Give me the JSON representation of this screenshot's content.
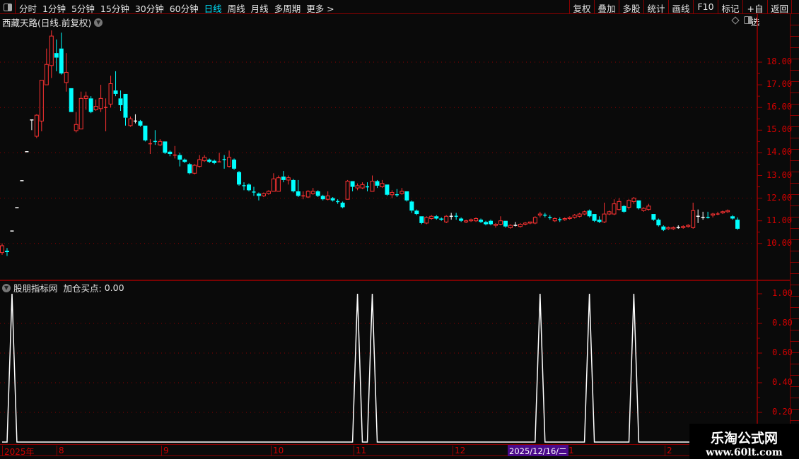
{
  "toolbar": {
    "periods": [
      "分时",
      "1分钟",
      "5分钟",
      "15分钟",
      "30分钟",
      "60分钟",
      "日线",
      "周线",
      "月线",
      "多周期",
      "更多 >"
    ],
    "active_period": "日线",
    "actions": [
      "复权",
      "叠加",
      "多股",
      "统计",
      "画线",
      "F10",
      "标记",
      "+自选",
      "返回"
    ]
  },
  "main_chart": {
    "title": "西藏天路(日线.前复权)",
    "type": "candlestick",
    "y_ticks": [
      "18.00",
      "17.00",
      "16.00",
      "15.00",
      "14.00",
      "13.00",
      "12.00",
      "11.00",
      "10.00"
    ],
    "ylim": [
      9.1,
      19.6
    ],
    "colors": {
      "up": "#ff3232",
      "down": "#00ffff",
      "flat": "#ffffff",
      "grid": "#8b0000",
      "axis_text": "#d40000"
    },
    "candles": [
      [
        9.6,
        10.0,
        9.5,
        9.9
      ],
      [
        9.68,
        9.8,
        9.45,
        9.62
      ],
      [
        10.55,
        10.55,
        10.55,
        10.55,
        "w"
      ],
      [
        11.58,
        11.58,
        11.58,
        11.58,
        "w"
      ],
      [
        12.77,
        12.77,
        12.77,
        12.77,
        "w"
      ],
      [
        14.05,
        14.05,
        14.05,
        14.05,
        "w"
      ],
      [
        15.45,
        15.45,
        15.0,
        15.45,
        "w"
      ],
      [
        14.73,
        15.7,
        14.65,
        15.66
      ],
      [
        15.4,
        17.2,
        14.95,
        17.2
      ],
      [
        17.0,
        18.6,
        17.0,
        17.9
      ],
      [
        17.85,
        19.4,
        17.3,
        19.15
      ],
      [
        18.4,
        19.0,
        17.6,
        18.2
      ],
      [
        18.6,
        19.3,
        17.45,
        17.5
      ],
      [
        17.1,
        18.4,
        16.7,
        17.55
      ],
      [
        16.85,
        16.85,
        15.8,
        15.8
      ],
      [
        14.98,
        15.8,
        14.9,
        15.25
      ],
      [
        15.05,
        16.7,
        15.05,
        16.4
      ],
      [
        16.4,
        16.7,
        15.9,
        16.5
      ],
      [
        16.4,
        16.5,
        15.75,
        15.8
      ],
      [
        15.9,
        16.35,
        15.85,
        16.05
      ],
      [
        15.95,
        17.0,
        15.8,
        16.4
      ],
      [
        16.0,
        16.4,
        14.95,
        16.0,
        "r"
      ],
      [
        16.15,
        17.4,
        16.0,
        17.05
      ],
      [
        16.75,
        17.6,
        16.5,
        16.6
      ],
      [
        16.4,
        16.75,
        15.85,
        16.1
      ],
      [
        16.6,
        16.6,
        15.2,
        15.55
      ],
      [
        15.2,
        15.6,
        15.15,
        15.5
      ],
      [
        15.4,
        15.7,
        15.3,
        15.4,
        "w"
      ],
      [
        15.4,
        15.45,
        15.15,
        15.2
      ],
      [
        15.2,
        15.2,
        14.5,
        14.55
      ],
      [
        14.4,
        14.6,
        13.95,
        14.4,
        "r"
      ],
      [
        14.5,
        15.0,
        14.35,
        14.5,
        "c"
      ],
      [
        14.35,
        14.6,
        14.3,
        14.5
      ],
      [
        14.5,
        14.5,
        13.95,
        14.0
      ],
      [
        14.05,
        14.1,
        13.85,
        13.95
      ],
      [
        13.9,
        14.3,
        13.75,
        13.9,
        "r"
      ],
      [
        13.9,
        14.0,
        13.4,
        13.7
      ],
      [
        13.7,
        13.75,
        13.55,
        13.6
      ],
      [
        13.5,
        13.55,
        13.05,
        13.1
      ],
      [
        13.1,
        13.5,
        13.05,
        13.45
      ],
      [
        13.4,
        13.9,
        13.35,
        13.7
      ],
      [
        13.65,
        13.9,
        13.6,
        13.8
      ],
      [
        13.7,
        13.75,
        13.55,
        13.6
      ],
      [
        13.65,
        13.7,
        13.5,
        13.55
      ],
      [
        13.6,
        14.0,
        13.6,
        13.6,
        "r"
      ],
      [
        13.7,
        13.9,
        13.3,
        13.7,
        "c"
      ],
      [
        13.4,
        14.1,
        13.35,
        13.8
      ],
      [
        13.7,
        13.75,
        13.25,
        13.3
      ],
      [
        13.15,
        13.2,
        12.55,
        12.6
      ],
      [
        12.55,
        12.7,
        12.35,
        12.55,
        "c"
      ],
      [
        12.6,
        12.65,
        12.3,
        12.35
      ],
      [
        12.27,
        12.5,
        12.1,
        12.27,
        "c"
      ],
      [
        12.2,
        12.25,
        11.9,
        12.1
      ],
      [
        12.1,
        12.25,
        12.05,
        12.2
      ],
      [
        12.2,
        12.35,
        12.15,
        12.3
      ],
      [
        12.3,
        13.1,
        12.3,
        12.85
      ],
      [
        12.3,
        13.0,
        12.3,
        12.9
      ],
      [
        12.95,
        13.2,
        12.7,
        12.8
      ],
      [
        12.8,
        13.0,
        12.6,
        12.9
      ],
      [
        12.8,
        12.85,
        12.25,
        12.3
      ],
      [
        12.3,
        12.8,
        12.05,
        12.1
      ],
      [
        12.1,
        12.3,
        11.95,
        12.1,
        "r"
      ],
      [
        12.05,
        12.35,
        12.0,
        12.3
      ],
      [
        12.2,
        12.45,
        12.15,
        12.3
      ],
      [
        12.3,
        12.35,
        12.05,
        12.1
      ],
      [
        12.1,
        12.15,
        11.9,
        11.95
      ],
      [
        11.95,
        12.3,
        11.9,
        12.1
      ],
      [
        12.0,
        12.05,
        11.85,
        11.9
      ],
      [
        11.85,
        11.95,
        11.75,
        11.85,
        "c"
      ],
      [
        11.8,
        11.85,
        11.55,
        11.6
      ],
      [
        11.95,
        12.8,
        11.95,
        12.75
      ],
      [
        12.75,
        12.75,
        12.3,
        12.5
      ],
      [
        12.45,
        12.65,
        12.35,
        12.55
      ],
      [
        12.45,
        12.7,
        12.4,
        12.6
      ],
      [
        12.5,
        12.7,
        12.3,
        12.5,
        "c"
      ],
      [
        12.3,
        13.0,
        12.3,
        12.75
      ],
      [
        12.75,
        12.8,
        12.45,
        12.55
      ],
      [
        12.5,
        12.8,
        12.45,
        12.65
      ],
      [
        12.6,
        12.6,
        12.1,
        12.15
      ],
      [
        12.15,
        12.35,
        12.0,
        12.25
      ],
      [
        12.15,
        12.4,
        12.05,
        12.15,
        "c"
      ],
      [
        12.2,
        12.45,
        12.15,
        12.3
      ],
      [
        12.3,
        12.3,
        11.85,
        11.9
      ],
      [
        11.85,
        11.9,
        11.35,
        11.45
      ],
      [
        11.45,
        11.5,
        11.25,
        11.3
      ],
      [
        11.2,
        11.2,
        10.85,
        10.9
      ],
      [
        10.9,
        11.2,
        10.85,
        11.15
      ],
      [
        11.1,
        11.25,
        11.05,
        11.2
      ],
      [
        11.2,
        11.25,
        11.05,
        11.1
      ],
      [
        11.1,
        11.15,
        11.0,
        11.05
      ],
      [
        10.95,
        11.25,
        10.9,
        11.2
      ],
      [
        11.2,
        11.35,
        11.05,
        11.2,
        "w"
      ],
      [
        11.2,
        11.35,
        11.05,
        11.2,
        "c"
      ],
      [
        11.1,
        11.15,
        10.95,
        11.0
      ],
      [
        10.95,
        11.05,
        10.9,
        11.0
      ],
      [
        11.0,
        11.1,
        10.95,
        11.05
      ],
      [
        11.0,
        11.15,
        10.95,
        11.1
      ],
      [
        11.05,
        11.1,
        10.9,
        10.95
      ],
      [
        10.95,
        11.0,
        10.8,
        10.85
      ],
      [
        11.0,
        11.05,
        10.8,
        10.85
      ],
      [
        10.8,
        10.9,
        10.7,
        10.85
      ],
      [
        10.85,
        11.2,
        10.8,
        11.0
      ],
      [
        11.0,
        11.0,
        10.7,
        10.75
      ],
      [
        10.7,
        10.85,
        10.65,
        10.8
      ],
      [
        10.8,
        10.95,
        10.75,
        10.8,
        "w"
      ],
      [
        10.75,
        10.9,
        10.7,
        10.85
      ],
      [
        10.85,
        10.95,
        10.8,
        10.9
      ],
      [
        10.9,
        10.95,
        10.85,
        10.95
      ],
      [
        10.9,
        11.2,
        10.85,
        11.15
      ],
      [
        11.25,
        11.4,
        11.15,
        11.3
      ],
      [
        11.25,
        11.35,
        11.15,
        11.25,
        "c"
      ],
      [
        11.15,
        11.25,
        11.05,
        11.15,
        "c"
      ],
      [
        11.0,
        11.15,
        10.95,
        11.1
      ],
      [
        11.05,
        11.15,
        10.95,
        11.05,
        "c"
      ],
      [
        11.05,
        11.15,
        11.0,
        11.1
      ],
      [
        11.1,
        11.2,
        11.05,
        11.15
      ],
      [
        11.15,
        11.3,
        11.1,
        11.25
      ],
      [
        11.2,
        11.35,
        11.15,
        11.3
      ],
      [
        11.3,
        11.45,
        11.25,
        11.4
      ],
      [
        11.45,
        11.5,
        11.15,
        11.2
      ],
      [
        11.3,
        11.3,
        10.95,
        11.0
      ],
      [
        11.05,
        11.2,
        10.9,
        10.95
      ],
      [
        10.95,
        11.8,
        10.9,
        11.3
      ],
      [
        11.3,
        11.45,
        11.25,
        11.4
      ],
      [
        11.3,
        11.95,
        11.25,
        11.75
      ],
      [
        11.5,
        12.0,
        11.45,
        11.85
      ],
      [
        11.65,
        11.7,
        11.35,
        11.4
      ],
      [
        11.6,
        11.95,
        11.5,
        11.9
      ],
      [
        11.85,
        12.05,
        11.75,
        12.0
      ],
      [
        11.9,
        11.9,
        11.5,
        11.55
      ],
      [
        11.45,
        11.6,
        11.4,
        11.55
      ],
      [
        11.5,
        11.75,
        11.45,
        11.65
      ],
      [
        11.3,
        11.3,
        11.0,
        11.05
      ],
      [
        11.05,
        11.1,
        10.75,
        10.8
      ],
      [
        10.75,
        10.8,
        10.55,
        10.6
      ],
      [
        10.65,
        10.75,
        10.6,
        10.7
      ],
      [
        10.65,
        10.75,
        10.6,
        10.7
      ],
      [
        10.7,
        10.8,
        10.65,
        10.7,
        "w"
      ],
      [
        10.7,
        10.8,
        10.65,
        10.75
      ],
      [
        10.75,
        10.85,
        10.7,
        10.8
      ],
      [
        10.7,
        11.8,
        10.65,
        11.45
      ],
      [
        11.2,
        11.5,
        10.9,
        11.2,
        "w"
      ],
      [
        11.15,
        11.4,
        11.05,
        11.15,
        "w"
      ],
      [
        11.15,
        11.4,
        11.1,
        11.15,
        "c"
      ],
      [
        11.25,
        11.35,
        11.15,
        11.3
      ],
      [
        11.3,
        11.4,
        11.25,
        11.3,
        "r"
      ],
      [
        11.35,
        11.45,
        11.3,
        11.4
      ],
      [
        11.4,
        11.5,
        11.35,
        11.45
      ],
      [
        11.2,
        11.25,
        11.05,
        11.1
      ],
      [
        11.05,
        11.15,
        10.6,
        10.65
      ]
    ]
  },
  "indicator": {
    "title": "股朋指标网",
    "label": "加仓买点:",
    "value": "0.00",
    "y_ticks": [
      "1.00",
      "0.80",
      "0.60",
      "0.40",
      "0.20"
    ],
    "ylim": [
      0,
      1
    ],
    "line_color": "#ffffff",
    "signal_bar_indices": [
      2,
      72,
      75,
      109,
      119,
      128
    ]
  },
  "date_axis": {
    "labels": [
      "2025年",
      "8",
      "9",
      "10",
      "11",
      "12",
      "1",
      "2"
    ],
    "highlight": "2025/12/16/二"
  },
  "watermark": {
    "line1": "乐淘公式网",
    "line2": "www.60lt.com"
  }
}
